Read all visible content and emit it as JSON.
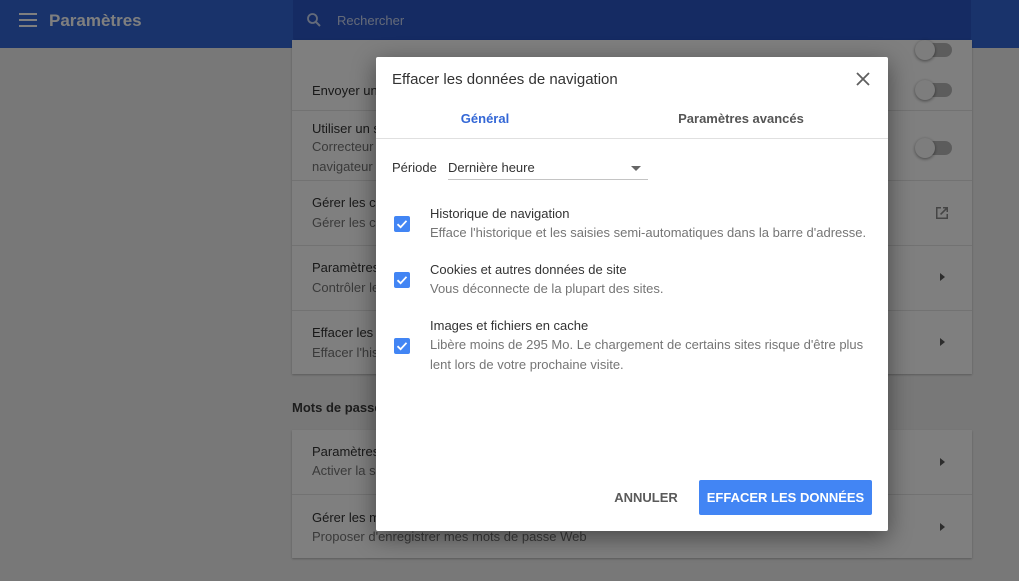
{
  "header": {
    "title": "Paramètres",
    "search_placeholder": "Rechercher"
  },
  "background": {
    "rows": [
      {
        "title": "Envoyer une",
        "subtitle": ""
      },
      {
        "title": "Utiliser un s",
        "subtitle_lines": [
          "Correcteur",
          "navigateur"
        ]
      },
      {
        "title": "Gérer les ce",
        "subtitle": "Gérer les ce"
      },
      {
        "title": "Paramètres",
        "subtitle": "Contrôler le"
      },
      {
        "title": "Effacer les",
        "subtitle": "Effacer l'his"
      }
    ],
    "section_passwords": "Mots de passe",
    "password_rows": [
      {
        "title": "Paramètres",
        "subtitle": "Activer la s"
      },
      {
        "title": "Gérer les m",
        "subtitle": "Proposer d'enregistrer mes mots de passe Web"
      }
    ]
  },
  "dialog": {
    "title": "Effacer les données de navigation",
    "tabs": [
      {
        "label": "Général",
        "active": true
      },
      {
        "label": "Paramètres avancés",
        "active": false
      }
    ],
    "period_label": "Période",
    "period_value": "Dernière heure",
    "items": [
      {
        "title": "Historique de navigation",
        "description": "Efface l'historique et les saisies semi-automatiques dans la barre d'adresse.",
        "checked": true
      },
      {
        "title": "Cookies et autres données de site",
        "description": "Vous déconnecte de la plupart des sites.",
        "checked": true
      },
      {
        "title": "Images et fichiers en cache",
        "description": "Libère moins de 295 Mo. Le chargement de certains sites risque d'être plus lent lors de votre prochaine visite.",
        "checked": true
      }
    ],
    "cancel_label": "ANNULER",
    "confirm_label": "EFFACER LES DONNÉES"
  },
  "colors": {
    "accent": "#4285f4",
    "header": "#3367d6",
    "overlay": "#000000"
  },
  "icons": [
    "menu-icon",
    "search-icon",
    "close-icon",
    "check-icon",
    "external-link-icon",
    "chevron-right-icon",
    "dropdown-arrow-icon"
  ]
}
